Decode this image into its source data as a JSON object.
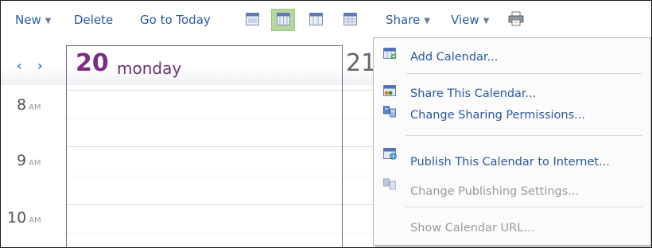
{
  "toolbar": {
    "new_label": "New",
    "delete_label": "Delete",
    "go_to_today_label": "Go to Today",
    "share_label": "Share",
    "view_label": "View",
    "view_icons": [
      "day-view-icon",
      "week-view-icon",
      "work-week-view-icon",
      "month-view-icon"
    ],
    "selected_view_index": 1,
    "print_icon": "printer-icon"
  },
  "calendar": {
    "prev_arrow": "‹",
    "next_arrow": "›",
    "day_number": "20",
    "day_name": "monday",
    "next_day_partial": "21",
    "hours": [
      {
        "hour": "8",
        "ampm": "AM"
      },
      {
        "hour": "9",
        "ampm": "AM"
      },
      {
        "hour": "10",
        "ampm": "AM"
      }
    ],
    "accent_color": "#7b2d84"
  },
  "share_menu": {
    "items": [
      {
        "label": "Add Calendar...",
        "icon": "add-calendar-icon",
        "enabled": true
      },
      {
        "label": "Share This Calendar...",
        "icon": "share-calendar-icon",
        "enabled": true
      },
      {
        "label": "Change Sharing Permissions...",
        "icon": "sharing-permissions-icon",
        "enabled": true
      },
      {
        "label": "Publish This Calendar to Internet...",
        "icon": "publish-calendar-icon",
        "enabled": true
      },
      {
        "label": "Change Publishing Settings...",
        "icon": "publishing-settings-icon",
        "enabled": false
      },
      {
        "label": "Show Calendar URL...",
        "enabled": false
      }
    ]
  }
}
